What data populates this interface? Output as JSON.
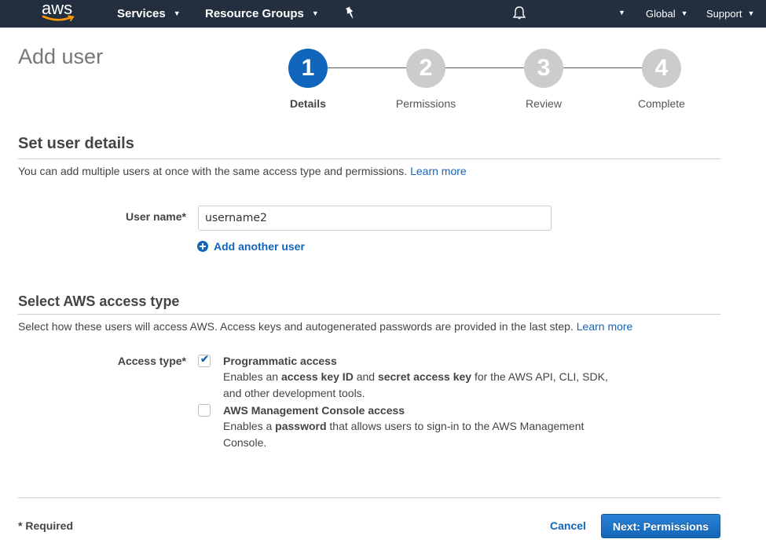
{
  "nav": {
    "logo_text": "aws",
    "services_label": "Services",
    "resource_groups_label": "Resource Groups",
    "region_label": "Global",
    "support_label": "Support",
    "caret": "▼",
    "colors": {
      "bar": "#232f3e",
      "logo_smile": "#f90"
    }
  },
  "page": {
    "title": "Add user"
  },
  "stepper": {
    "steps": [
      {
        "number": "1",
        "label": "Details",
        "active": true
      },
      {
        "number": "2",
        "label": "Permissions",
        "active": false
      },
      {
        "number": "3",
        "label": "Review",
        "active": false
      },
      {
        "number": "4",
        "label": "Complete",
        "active": false
      }
    ],
    "active_color": "#1166bb",
    "inactive_color": "#cccccc"
  },
  "user_details": {
    "title": "Set user details",
    "description": "You can add multiple users at once with the same access type and permissions.",
    "learn_more": "Learn more",
    "username_label": "User name*",
    "username_value": "username2",
    "add_another_user": "Add another user"
  },
  "access_type": {
    "title": "Select AWS access type",
    "description": "Select how these users will access AWS. Access keys and autogenerated passwords are provided in the last step.",
    "learn_more": "Learn more",
    "label": "Access type*",
    "options": [
      {
        "title": "Programmatic access",
        "checked": true,
        "desc_parts": [
          "Enables an ",
          "access key ID",
          " and ",
          "secret access key",
          " for the AWS API, CLI, SDK, and other development tools."
        ]
      },
      {
        "title": "AWS Management Console access",
        "checked": false,
        "desc_parts": [
          "Enables a ",
          "password",
          " that allows users to sign-in to the AWS Management Console."
        ]
      }
    ]
  },
  "footer": {
    "required_note": "* Required",
    "cancel_label": "Cancel",
    "next_label": "Next: Permissions"
  }
}
